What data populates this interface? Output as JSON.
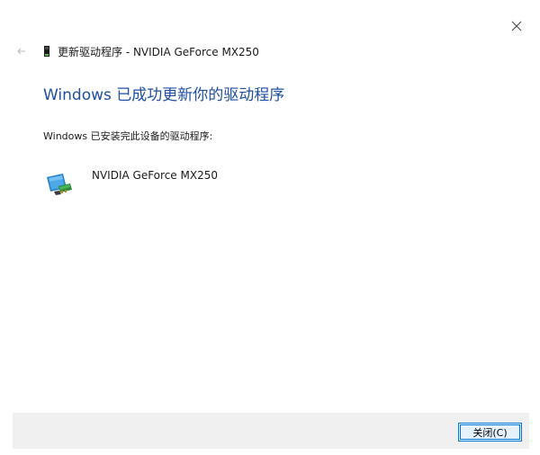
{
  "window": {
    "title": "更新驱动程序 - NVIDIA GeForce MX250",
    "close_icon": "close-icon",
    "back_icon": "back-arrow-icon"
  },
  "main": {
    "heading": "Windows 已成功更新你的驱动程序",
    "description": "Windows 已安装完此设备的驱动程序:",
    "device": {
      "name": "NVIDIA GeForce MX250",
      "icon": "display-adapter-icon"
    }
  },
  "footer": {
    "close_button_label": "关闭(C)"
  },
  "colors": {
    "heading": "#1f4fa3",
    "footer_bg": "#f0f0f0",
    "button_border": "#0078d7",
    "button_bg": "#e5f1fb"
  }
}
